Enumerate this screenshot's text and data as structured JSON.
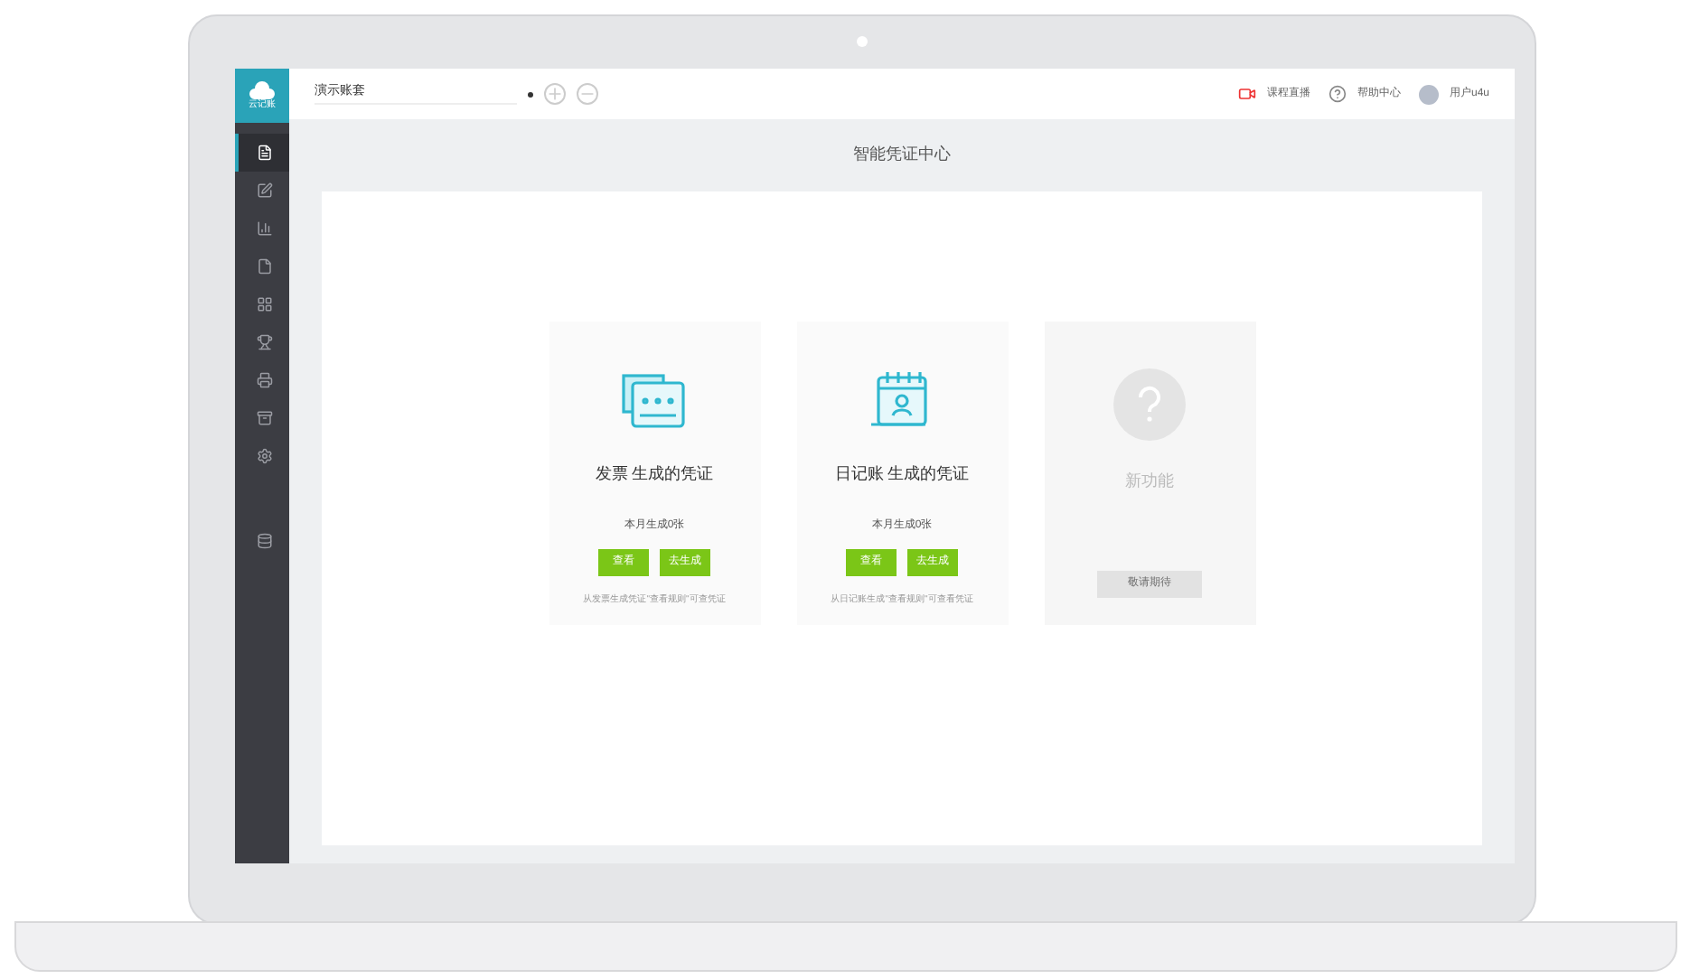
{
  "logo": {
    "text": "云记账"
  },
  "topbar": {
    "account": "演示账套",
    "links": [
      {
        "label": "课程直播",
        "kind": "live"
      },
      {
        "label": "帮助中心",
        "kind": "help"
      }
    ],
    "user": "用户u4u"
  },
  "sidebar": {
    "items": [
      {
        "selected": true
      },
      {
        "selected": false
      },
      {
        "selected": false
      },
      {
        "selected": false
      },
      {
        "selected": false
      },
      {
        "selected": false
      },
      {
        "selected": false
      },
      {
        "selected": false
      },
      {
        "selected": false
      },
      {
        "selected": false
      }
    ]
  },
  "page_title": "智能凭证中心",
  "cards": [
    {
      "kind": "invoice",
      "title": "发票 生成的凭证",
      "count": "本月生成0张",
      "buttons": [
        "查看",
        "去生成"
      ],
      "hint": "从发票生成凭证\"查看规则\"可查凭证",
      "disabled": false
    },
    {
      "kind": "journal",
      "title": "日记账 生成的凭证",
      "count": "本月生成0张",
      "buttons": [
        "查看",
        "去生成"
      ],
      "hint": "从日记账生成\"查看规则\"可查看凭证",
      "disabled": false
    },
    {
      "kind": "new",
      "title": "新功能",
      "buttons": [
        "敬请期待"
      ],
      "disabled": true
    }
  ]
}
